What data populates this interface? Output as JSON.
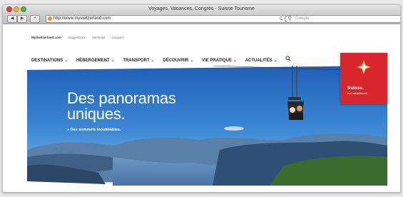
{
  "window": {
    "title": "Voyages, Vacances, Congrès - Suisse Tourisme",
    "url": "http://www.myswitzerland.com",
    "search_placeholder": "Google",
    "nav_back": "◀",
    "nav_forward": "▶",
    "nav_add": "+",
    "refresh": "C"
  },
  "utility_nav": {
    "site": "MySwitzerland.com",
    "items": [
      "Suggestions",
      "Meetings",
      "Langues"
    ]
  },
  "main_nav": {
    "items": [
      {
        "label": "DESTINATIONS"
      },
      {
        "label": "HÉBERGEMENT"
      },
      {
        "label": "TRANSPORT"
      },
      {
        "label": "DÉCOUVRIR"
      },
      {
        "label": "VIE PRATIQUE"
      },
      {
        "label": "ACTUALITÉS"
      }
    ],
    "chevron": "⌄"
  },
  "brand": {
    "name": "Suisse.",
    "tagline": "tout naturellement"
  },
  "hero": {
    "title_line1": "Des panoramas",
    "title_line2": "uniques.",
    "link": "» Des sommets inoubliables."
  },
  "colors": {
    "brand_red": "#d8262c",
    "sky_blue": "#2f73c8"
  }
}
